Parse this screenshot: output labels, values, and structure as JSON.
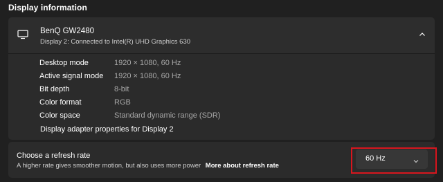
{
  "section": {
    "title": "Display information"
  },
  "display": {
    "name": "BenQ GW2480",
    "subtitle": "Display 2: Connected to Intel(R) UHD Graphics 630",
    "icon": "monitor-icon",
    "collapse_icon": "chevron-up-icon"
  },
  "properties": [
    {
      "label": "Desktop mode",
      "value": "1920 × 1080, 60 Hz"
    },
    {
      "label": "Active signal mode",
      "value": "1920 × 1080, 60 Hz"
    },
    {
      "label": "Bit depth",
      "value": "8-bit"
    },
    {
      "label": "Color format",
      "value": "RGB"
    },
    {
      "label": "Color space",
      "value": "Standard dynamic range (SDR)"
    }
  ],
  "adapter_link": "Display adapter properties for Display 2",
  "refresh": {
    "title": "Choose a refresh rate",
    "description": "A higher rate gives smoother motion, but also uses more power",
    "link": "More about refresh rate",
    "selected": "60 Hz",
    "chevron_icon": "chevron-down-icon"
  },
  "colors": {
    "background": "#202020",
    "card": "#2b2b2b",
    "highlight": "#d9161e"
  }
}
